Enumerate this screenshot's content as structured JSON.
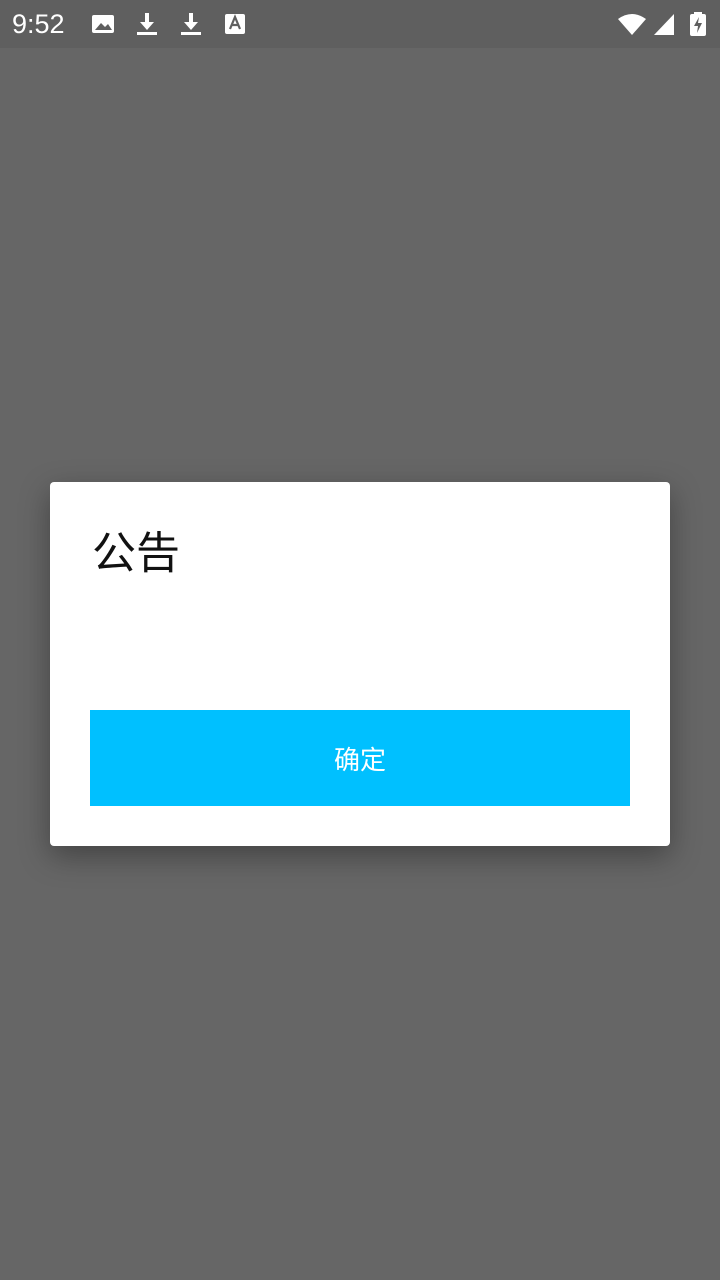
{
  "status_bar": {
    "time": "9:52",
    "left_icons": [
      "image-icon",
      "download-icon",
      "download-icon",
      "font-a-icon"
    ],
    "right_icons": [
      "wifi-icon",
      "cell-signal-icon",
      "battery-charging-icon"
    ]
  },
  "dialog": {
    "title": "公告",
    "message": "",
    "confirm_label": "确定"
  },
  "colors": {
    "accent": "#00c0ff",
    "scrim": "#666666",
    "status_bar": "#5f5f5f"
  }
}
